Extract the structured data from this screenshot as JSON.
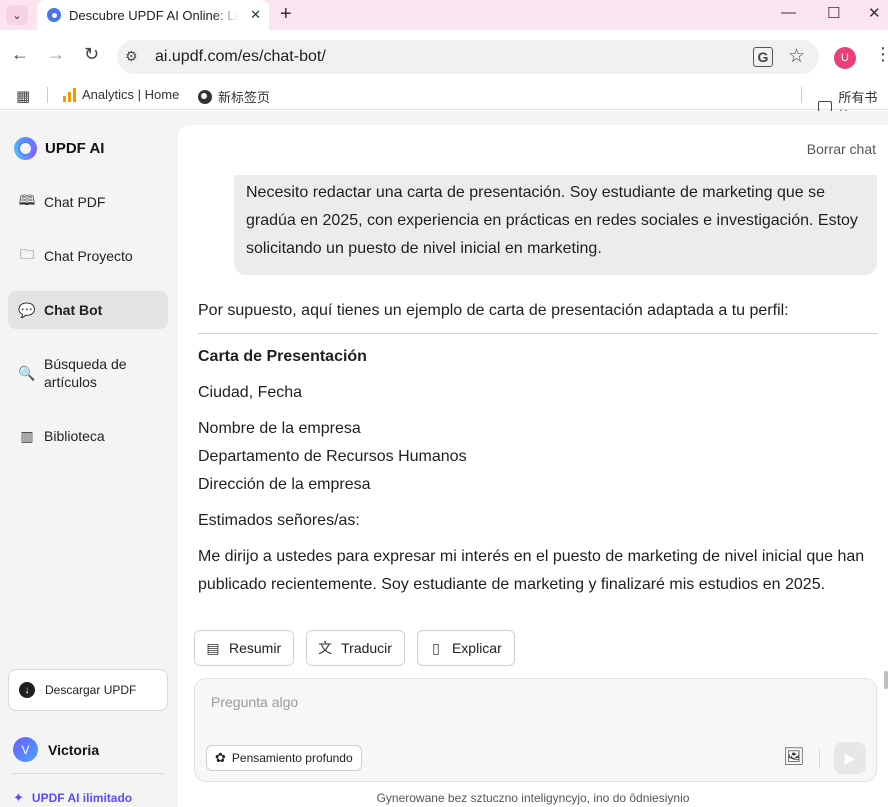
{
  "browser": {
    "tab_title": "Descubre UPDF AI Online: La",
    "url": "ai.updf.com/es/chat-bot/",
    "profile_initial": "U",
    "bookmarks": [
      {
        "label": "Analytics | Home"
      },
      {
        "label": "新标签页"
      }
    ],
    "all_bookmarks_label": "所有书签"
  },
  "sidebar": {
    "brand": "UPDF AI",
    "items": [
      {
        "label": "Chat PDF",
        "icon": "book-open-icon"
      },
      {
        "label": "Chat Proyecto",
        "icon": "folder-plus-icon"
      },
      {
        "label": "Chat Bot",
        "icon": "chat-bot-icon",
        "active": true
      },
      {
        "label": "Búsqueda de artículos",
        "icon": "article-search-icon"
      },
      {
        "label": "Biblioteca",
        "icon": "library-icon"
      }
    ],
    "download_label": "Descargar UPDF",
    "user_initial": "V",
    "user_name": "Victoria",
    "unlimited_label": "UPDF AI ilimitado"
  },
  "main": {
    "clear_chat": "Borrar chat",
    "user_message": "Necesito redactar una carta de presentación. Soy estudiante de marketing que se gradúa en 2025, con experiencia en prácticas en redes sociales e investigación. Estoy solicitando un puesto de nivel inicial en marketing.",
    "answer": {
      "intro": "Por supuesto, aquí tienes un ejemplo de carta de presentación adaptada a tu perfil:",
      "title": "Carta de Presentación",
      "city_date": "Ciudad, Fecha",
      "company_name": "Nombre de la empresa",
      "department": "Departamento de Recursos Humanos",
      "company_address": "Dirección de la empresa",
      "greeting": "Estimados señores/as:",
      "body": "Me dirijo a ustedes para expresar mi interés en el puesto de marketing de nivel inicial que han publicado recientemente. Soy estudiante de marketing y finalizaré mis estudios en 2025."
    },
    "actions": {
      "summarize": "Resumir",
      "translate": "Traducir",
      "explain": "Explicar"
    },
    "composer": {
      "placeholder": "Pregunta algo",
      "deep_think": "Pensamiento profundo"
    },
    "disclaimer": "Gynerowane bez sztuczno inteligyncyjo, ino do ôdniesiynio"
  }
}
